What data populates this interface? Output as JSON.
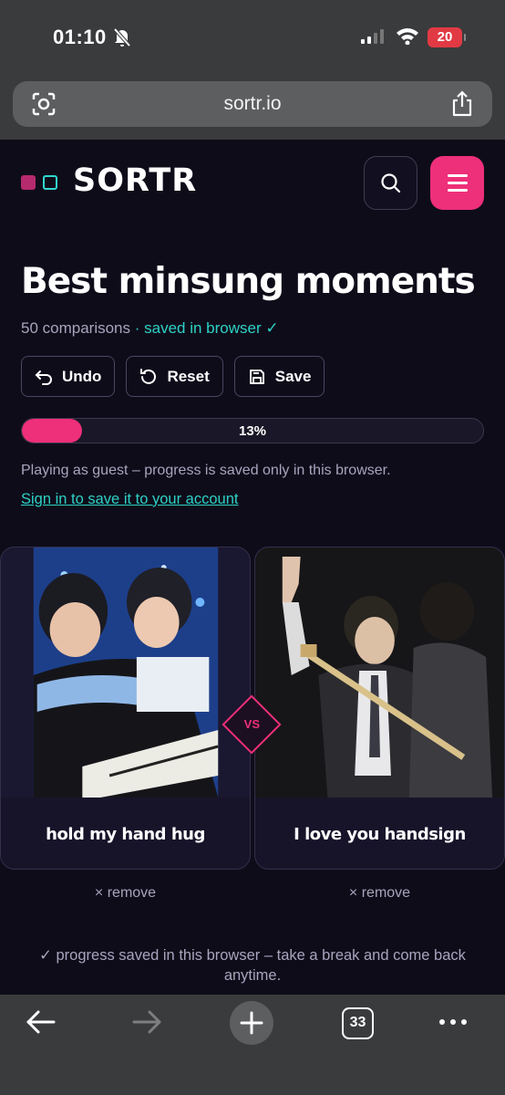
{
  "status_bar": {
    "time": "01:10",
    "battery": "20"
  },
  "browser": {
    "url": "sortr.io",
    "tab_count": "33"
  },
  "header": {
    "brand": "SORTR"
  },
  "sorter": {
    "title": "Best minsung moments",
    "comparisons": "50 comparisons",
    "saved_status": "· saved in browser ✓",
    "actions": {
      "undo": "Undo",
      "reset": "Reset",
      "save": "Save"
    },
    "progress": {
      "percent": 13,
      "label": "13%"
    },
    "guest_note": "Playing as guest – progress is saved only in this browser.",
    "signin_link": "Sign in to save it to your account",
    "left_option": {
      "label": "hold my hand hug",
      "remove": "× remove"
    },
    "right_option": {
      "label": "I love you handsign",
      "remove": "× remove"
    },
    "vs": "VS",
    "footer_note": "✓ progress saved in this browser – take a break and come back anytime."
  },
  "colors": {
    "accent": "#ee2f79",
    "teal": "#2dd2c6",
    "page_bg": "#0f0c1a"
  }
}
